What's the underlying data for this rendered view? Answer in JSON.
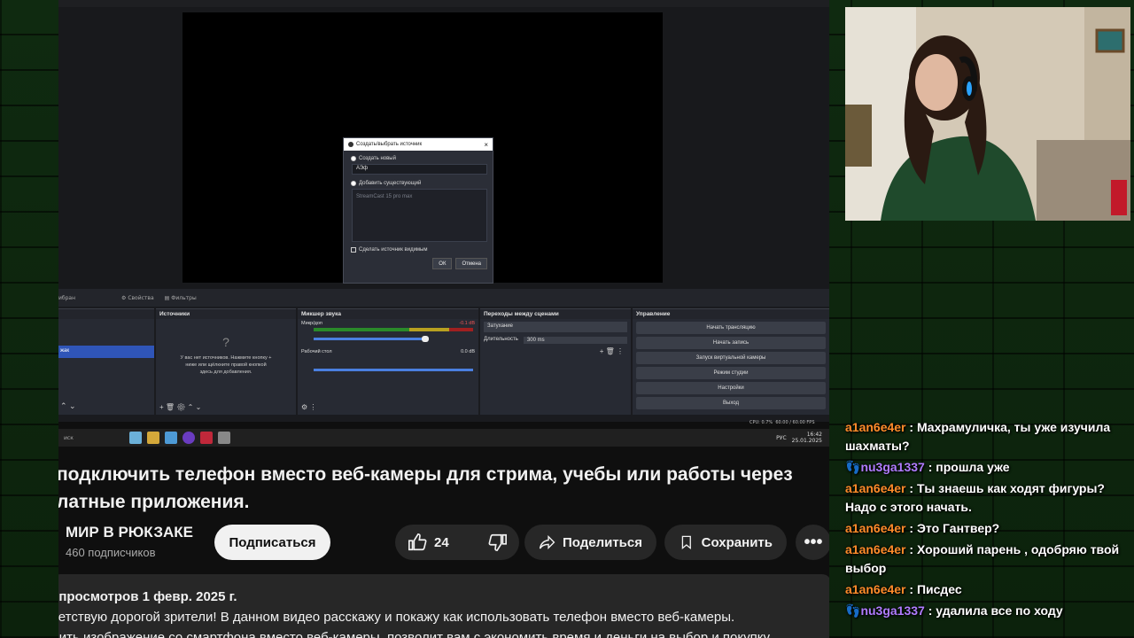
{
  "obs": {
    "dialog": {
      "title": "Создать/выбрать источник",
      "create_new": "Создать новый",
      "input_value": "АЭф",
      "add_existing": "Добавить существующий",
      "existing_item": "StreamCast 15 pro max",
      "make_visible": "Сделать источник видимым",
      "ok": "ОК",
      "cancel": "Отмена"
    },
    "dockbar": {
      "scene_label": "ибран",
      "properties": "Свойства",
      "filters": "Фильтры"
    },
    "scenes": {
      "selected": "жак"
    },
    "sources": {
      "title": "Источники",
      "empty_text": "У вас нет источников. Нажмите кнопку + ниже или щёлкните правой кнопкой здесь для добавления."
    },
    "mixer": {
      "title": "Микшер звука",
      "mic_label": "Микр/доп",
      "mic_db": "-0.1 dB",
      "desktop_label": "Рабочий стол",
      "desktop_db": "0.0 dB"
    },
    "transitions": {
      "title": "Переходы между сценами",
      "type": "Затухание",
      "duration_label": "Длительность",
      "duration_value": "300 ms"
    },
    "controls": {
      "title": "Управление",
      "buttons": [
        "Начать трансляцию",
        "Начать запись",
        "Запуск виртуальной камеры",
        "Режим студии",
        "Настройки",
        "Выход"
      ]
    },
    "status": {
      "cpu": "CPU: 0.7%",
      "fps": "60.00 / 60.00 FPS",
      "lang": "РУС",
      "time": "16:42",
      "date": "25.01.2025",
      "search": "иск"
    }
  },
  "video": {
    "title": "подключить телефон вместо веб-камеры для стрима, учебы или работы через латные приложения.",
    "title_line1": "подключить телефон вместо веб-камеры для стрима, учебы или работы через",
    "title_line2": "латные приложения.",
    "channel": "МИР В РЮКЗАКЕ",
    "subscribers": "460 подписчиков",
    "subscribe": "Подписаться",
    "likes": "24",
    "share": "Поделиться",
    "save": "Сохранить",
    "desc_line1": "/ просмотров  1 февр. 2025 г.",
    "desc_line2": "ветствую дорогой зрители! В данном видео расскажу и покажу как использовать телефон вместо веб-камеры.",
    "desc_line3": "лить изображение со смартфона вместо веб-камеры, позволит вам с экономить время и деньги на выбор и покупку"
  },
  "chat": [
    {
      "user": "a1an6e4er",
      "text": "Махрамуличка, ты уже изучила шахматы?",
      "badge": false
    },
    {
      "user": "nu3ga1337",
      "text": "прошла уже",
      "badge": true
    },
    {
      "user": "a1an6e4er",
      "text": "Ты знаешь как ходят фигуры? Надо с этого начать.",
      "badge": false
    },
    {
      "user": "a1an6e4er",
      "text": "Это Гантвер?",
      "badge": false
    },
    {
      "user": "a1an6e4er",
      "text": "Хороший парень , одобряю твой выбор",
      "badge": false
    },
    {
      "user": "a1an6e4er",
      "text": "Писдес",
      "badge": false
    },
    {
      "user": "nu3ga1337",
      "text": "удалила все по ходу",
      "badge": true
    }
  ],
  "colors": {
    "accent_user": "#ff8c2a",
    "badge_user": "#b07cff",
    "yt_bg": "#0f0f0f"
  }
}
